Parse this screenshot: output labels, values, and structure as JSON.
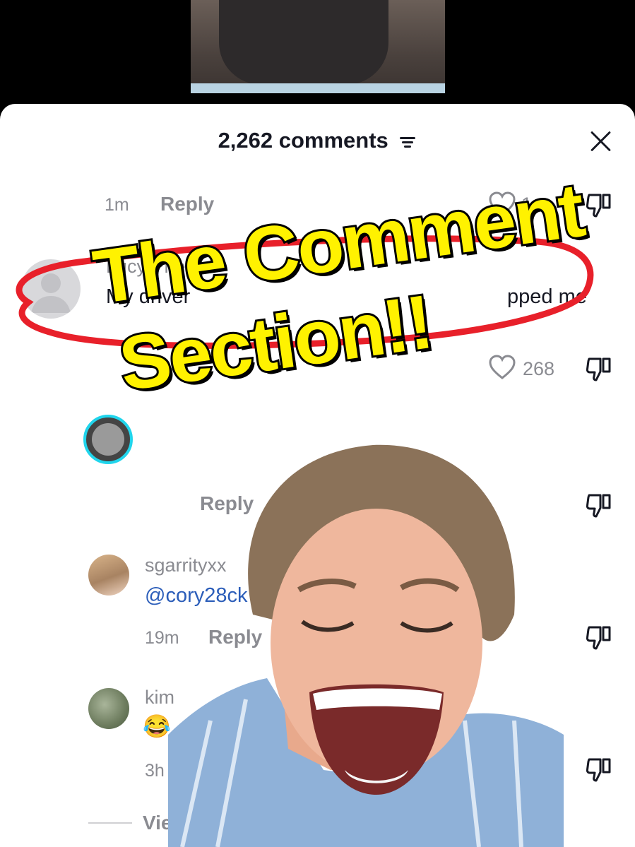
{
  "header": {
    "comment_count": "2,262 comments"
  },
  "comments": [
    {
      "time": "1m",
      "reply_label": "Reply",
      "like_count": "1"
    },
    {
      "username": "Lucy Phelan",
      "text_start": "My driver",
      "text_end": "pped me",
      "like_count": "268"
    },
    {
      "reply_label": "Reply"
    },
    {
      "username": "sgarrityxx",
      "text": "@cory28ck",
      "time": "19m",
      "reply_label": "Reply"
    },
    {
      "username": "kim",
      "text": "😂",
      "time": "3h"
    }
  ],
  "footer": {
    "view_more": "Vie"
  },
  "overlay": {
    "caption_line1": "The Comment",
    "caption_line2": "Section!!"
  },
  "colors": {
    "caption": "#fff200",
    "oval": "#e8202a",
    "mention": "#2b5db9"
  }
}
